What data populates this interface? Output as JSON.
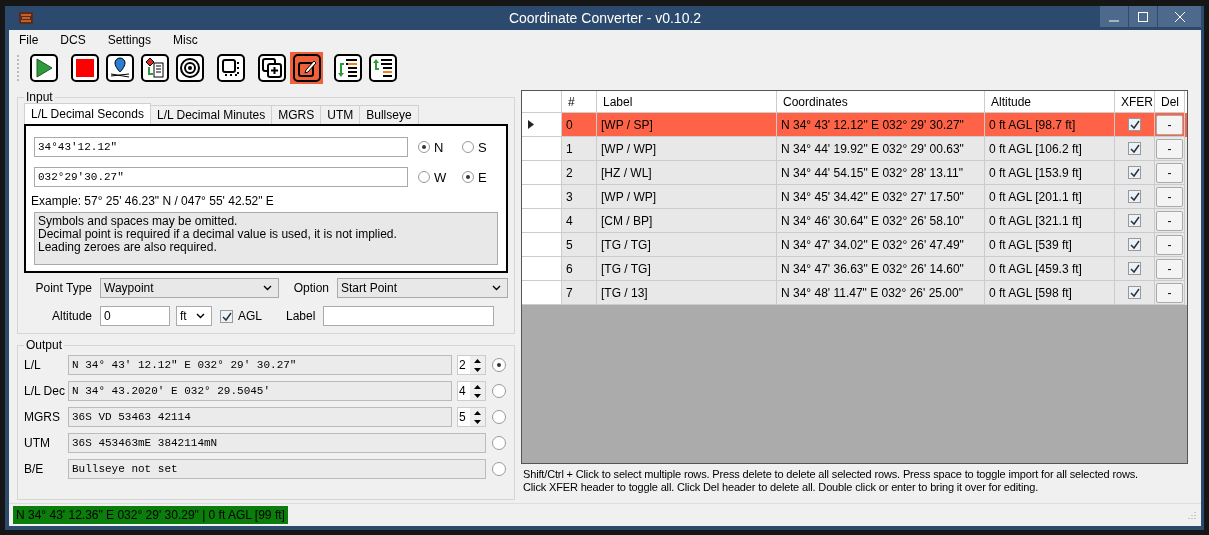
{
  "window": {
    "title": "Coordinate Converter - v0.10.2"
  },
  "menu": [
    "File",
    "DCS",
    "Settings",
    "Misc"
  ],
  "toolbar": [
    {
      "kind": "play",
      "selected": false
    },
    {
      "kind": "stop",
      "selected": false
    },
    {
      "kind": "pin",
      "selected": false
    },
    {
      "kind": "pin-list",
      "selected": false
    },
    {
      "kind": "target",
      "selected": false
    },
    {
      "kind": "screen",
      "selected": false
    },
    {
      "kind": "add",
      "selected": false
    },
    {
      "kind": "edit",
      "selected": true
    },
    {
      "kind": "list-down",
      "selected": false
    },
    {
      "kind": "list-up",
      "selected": false
    }
  ],
  "input": {
    "title": "Input",
    "tabs": [
      {
        "label": "L/L Decimal Seconds",
        "selected": true
      },
      {
        "label": "L/L Decimal Minutes",
        "selected": false
      },
      {
        "label": "MGRS",
        "selected": false
      },
      {
        "label": "UTM",
        "selected": false
      },
      {
        "label": "Bullseye",
        "selected": false
      }
    ],
    "fields": [
      {
        "value": "34°43'12.12\"",
        "options": [
          {
            "label": "N",
            "selected": true
          },
          {
            "label": "S",
            "selected": false
          }
        ]
      },
      {
        "value": "032°29'30.27\"",
        "options": [
          {
            "label": "W",
            "selected": false
          },
          {
            "label": "E",
            "selected": true
          }
        ]
      }
    ],
    "example": "Example: 57° 25' 46.23\" N / 047° 55' 42.52\" E",
    "notes": [
      "Symbols and spaces may be omitted.",
      "Decimal point is required if a decimal value is used, it is not implied.",
      "Leading zeroes are also required."
    ],
    "point_type": {
      "label": "Point Type",
      "value": "Waypoint"
    },
    "option": {
      "label": "Option",
      "value": "Start Point"
    },
    "altitude": {
      "label": "Altitude",
      "value": "0",
      "unit": "ft"
    },
    "agl": {
      "label": "AGL",
      "checked": true
    },
    "label_field": {
      "label": "Label"
    }
  },
  "output": {
    "title": "Output",
    "rows": [
      {
        "label": "L/L",
        "value": "N 34° 43' 12.12\" E 032° 29' 30.27\"",
        "precision": "2",
        "selected": true
      },
      {
        "label": "L/L Dec",
        "value": "N 34° 43.2020' E 032° 29.5045'",
        "precision": "4",
        "selected": false
      },
      {
        "label": "MGRS",
        "value": "36S VD 53463 42114",
        "precision": "5",
        "selected": false
      },
      {
        "label": "UTM",
        "value": "36S 453463mE 3842114mN",
        "selected": false
      },
      {
        "label": "B/E",
        "value": "Bullseye not set",
        "selected": false
      }
    ]
  },
  "table": {
    "columns": [
      "#",
      "Label",
      "Coordinates",
      "Altitude",
      "XFER",
      "Del"
    ],
    "rows": [
      {
        "num": "0",
        "label": "[WP / SP]",
        "coordinates": "N 34° 43' 12.12\" E 032° 29' 30.27\"",
        "altitude": "0 ft AGL [98.7 ft]",
        "xfer": true,
        "delete": "-",
        "selected": true
      },
      {
        "num": "1",
        "label": "[WP / WP]",
        "coordinates": "N 34° 44' 19.92\" E 032° 29' 00.63\"",
        "altitude": "0 ft AGL [106.2 ft]",
        "xfer": true,
        "delete": "-",
        "selected": false
      },
      {
        "num": "2",
        "label": "[HZ / WL]",
        "coordinates": "N 34° 44' 54.15\" E 032° 28' 13.11\"",
        "altitude": "0 ft AGL [153.9 ft]",
        "xfer": true,
        "delete": "-",
        "selected": false
      },
      {
        "num": "3",
        "label": "[WP / WP]",
        "coordinates": "N 34° 45' 34.42\" E 032° 27' 17.50\"",
        "altitude": "0 ft AGL [201.1 ft]",
        "xfer": true,
        "delete": "-",
        "selected": false
      },
      {
        "num": "4",
        "label": "[CM / BP]",
        "coordinates": "N 34° 46' 30.64\" E 032° 26' 58.10\"",
        "altitude": "0 ft AGL [321.1 ft]",
        "xfer": true,
        "delete": "-",
        "selected": false
      },
      {
        "num": "5",
        "label": "[TG / TG]",
        "coordinates": "N 34° 47' 34.02\" E 032° 26' 47.49\"",
        "altitude": "0 ft AGL [539 ft]",
        "xfer": true,
        "delete": "-",
        "selected": false
      },
      {
        "num": "6",
        "label": "[TG / TG]",
        "coordinates": "N 34° 47' 36.63\" E 032° 26' 14.60\"",
        "altitude": "0 ft AGL [459.3 ft]",
        "xfer": true,
        "delete": "-",
        "selected": false
      },
      {
        "num": "7",
        "label": "[TG / 13]",
        "coordinates": "N 34° 48' 11.47\" E 032° 26' 25.00\"",
        "altitude": "0 ft AGL [598 ft]",
        "xfer": true,
        "delete": "-",
        "selected": false
      }
    ]
  },
  "help": [
    "Shift/Ctrl + Click to select multiple rows. Press delete to delete all selected rows. Press space to toggle import for all selected rows.",
    "Click XFER header to toggle all. Click Del header to delete all. Double click or enter to bring it over for editing."
  ],
  "status_bar": {
    "text": "N 34° 43' 12.36\" E 032° 29' 30.29\" | 0 ft AGL [99 ft]"
  }
}
